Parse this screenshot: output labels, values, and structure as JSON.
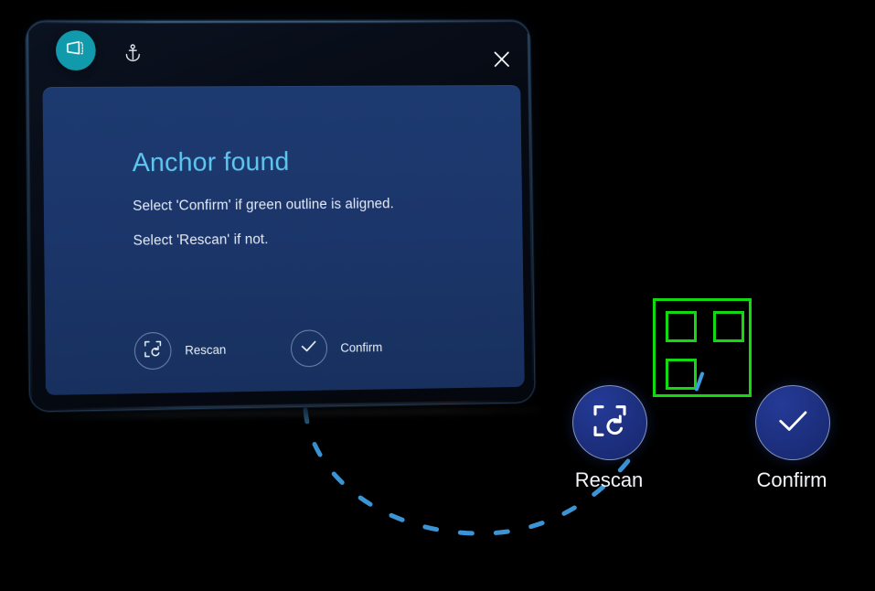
{
  "app": {
    "badge_icon": "screen-3d-icon",
    "anchor_icon": "anchor-icon",
    "close_icon": "close-icon",
    "accent_teal": "#119aab",
    "panel_blue": "#1b3569",
    "button_blue": "#1b2d7a",
    "marker_green": "#12d912",
    "title_blue": "#5fc6ef",
    "dash_blue": "#3e9de0"
  },
  "dialog": {
    "title": "Anchor found",
    "body_line_1": "Select 'Confirm' if green outline is aligned.",
    "body_line_2": "Select 'Rescan' if not.",
    "actions": [
      {
        "label": "Rescan",
        "icon": "rescan-icon"
      },
      {
        "label": "Confirm",
        "icon": "check-icon"
      }
    ]
  },
  "world_buttons": [
    {
      "label": "Rescan",
      "icon": "rescan-icon"
    },
    {
      "label": "Confirm",
      "icon": "check-icon"
    }
  ],
  "marker": {
    "name": "anchor-outline-marker",
    "squares": 3
  }
}
